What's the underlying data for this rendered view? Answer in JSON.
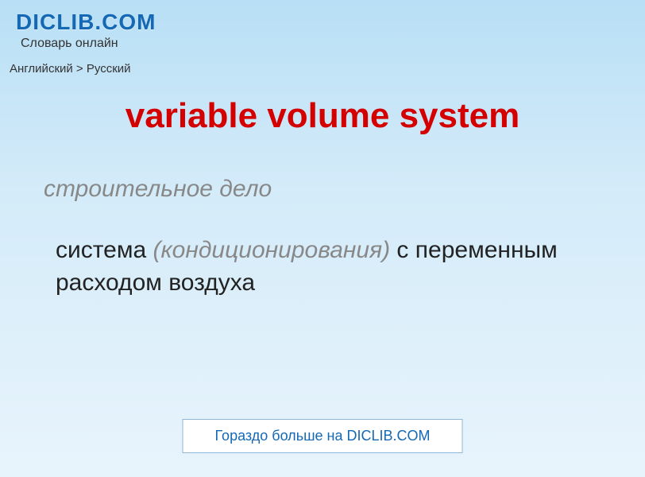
{
  "header": {
    "site_title": "DICLIB.COM",
    "site_subtitle": "Словарь онлайн"
  },
  "breadcrumb": {
    "text": "Английский > Русский"
  },
  "entry": {
    "term": "variable volume system",
    "category": "строительное дело",
    "definition_prefix": "система ",
    "definition_note": "(кондиционирования)",
    "definition_suffix": " с переменным расходом воздуха"
  },
  "footer": {
    "more_link": "Гораздо больше на DICLIB.COM"
  }
}
